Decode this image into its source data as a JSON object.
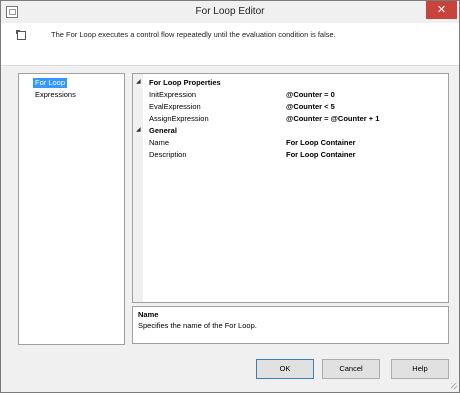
{
  "window": {
    "title": "For Loop Editor",
    "close_symbol": "✕"
  },
  "header": {
    "description": "The For Loop executes a control flow repeatedly until the evaluation condition is false."
  },
  "nav": {
    "items": [
      {
        "label": "For Loop",
        "selected": true
      },
      {
        "label": "Expressions",
        "selected": false
      }
    ]
  },
  "properties": {
    "categories": [
      {
        "label": "For Loop Properties",
        "rows": [
          {
            "name": "InitExpression",
            "value": "@Counter = 0"
          },
          {
            "name": "EvalExpression",
            "value": "@Counter < 5"
          },
          {
            "name": "AssignExpression",
            "value": "@Counter = @Counter + 1"
          }
        ]
      },
      {
        "label": "General",
        "rows": [
          {
            "name": "Name",
            "value": "For Loop Container"
          },
          {
            "name": "Description",
            "value": "For Loop Container"
          }
        ]
      }
    ]
  },
  "help": {
    "title": "Name",
    "text": "Specifies the name of the For Loop."
  },
  "buttons": {
    "ok": "OK",
    "cancel": "Cancel",
    "help": "Help"
  },
  "colors": {
    "selection": "#3399ff",
    "close_button": "#c7443c",
    "dialog_background": "#f0f0f0"
  }
}
